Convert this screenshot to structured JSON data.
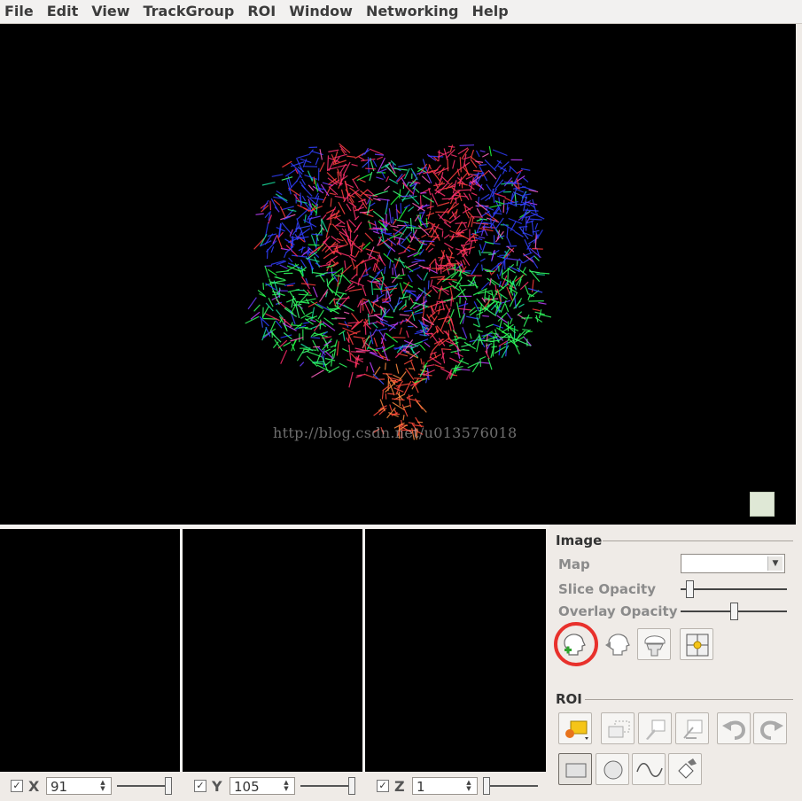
{
  "menubar": {
    "items": [
      "File",
      "Edit",
      "View",
      "TrackGroup",
      "ROI",
      "Window",
      "Networking",
      "Help"
    ]
  },
  "viewport": {
    "background": "#000000",
    "watermark": "http://blog.csdn.net/u013576018"
  },
  "slices": {
    "x": {
      "label": "X",
      "value": "91",
      "checked": true
    },
    "y": {
      "label": "Y",
      "value": "105",
      "checked": true
    },
    "z": {
      "label": "Z",
      "value": "1",
      "checked": true
    }
  },
  "panel": {
    "image_group": {
      "title": "Image",
      "map_label": "Map",
      "map_value": "",
      "slice_opacity_label": "Slice Opacity",
      "slice_opacity_level": 0.05,
      "overlay_opacity_label": "Overlay Opacity",
      "overlay_opacity_level": 0.5,
      "tools": [
        "add-image-icon",
        "import-head-icon",
        "head-slice-icon",
        "crosshair-icon"
      ]
    },
    "roi_group": {
      "title": "ROI",
      "tools_row1": [
        "new-roi-icon",
        "roi-copy-icon",
        "roi-edit-icon",
        "roi-delete-icon",
        "undo-icon",
        "redo-icon"
      ],
      "tools_row2": [
        "rectangle-icon",
        "circle-icon",
        "freehand-icon",
        "paint-bucket-icon"
      ]
    }
  },
  "colors": {
    "highlight": "#e8312c",
    "panel_bg": "#efebe7"
  }
}
